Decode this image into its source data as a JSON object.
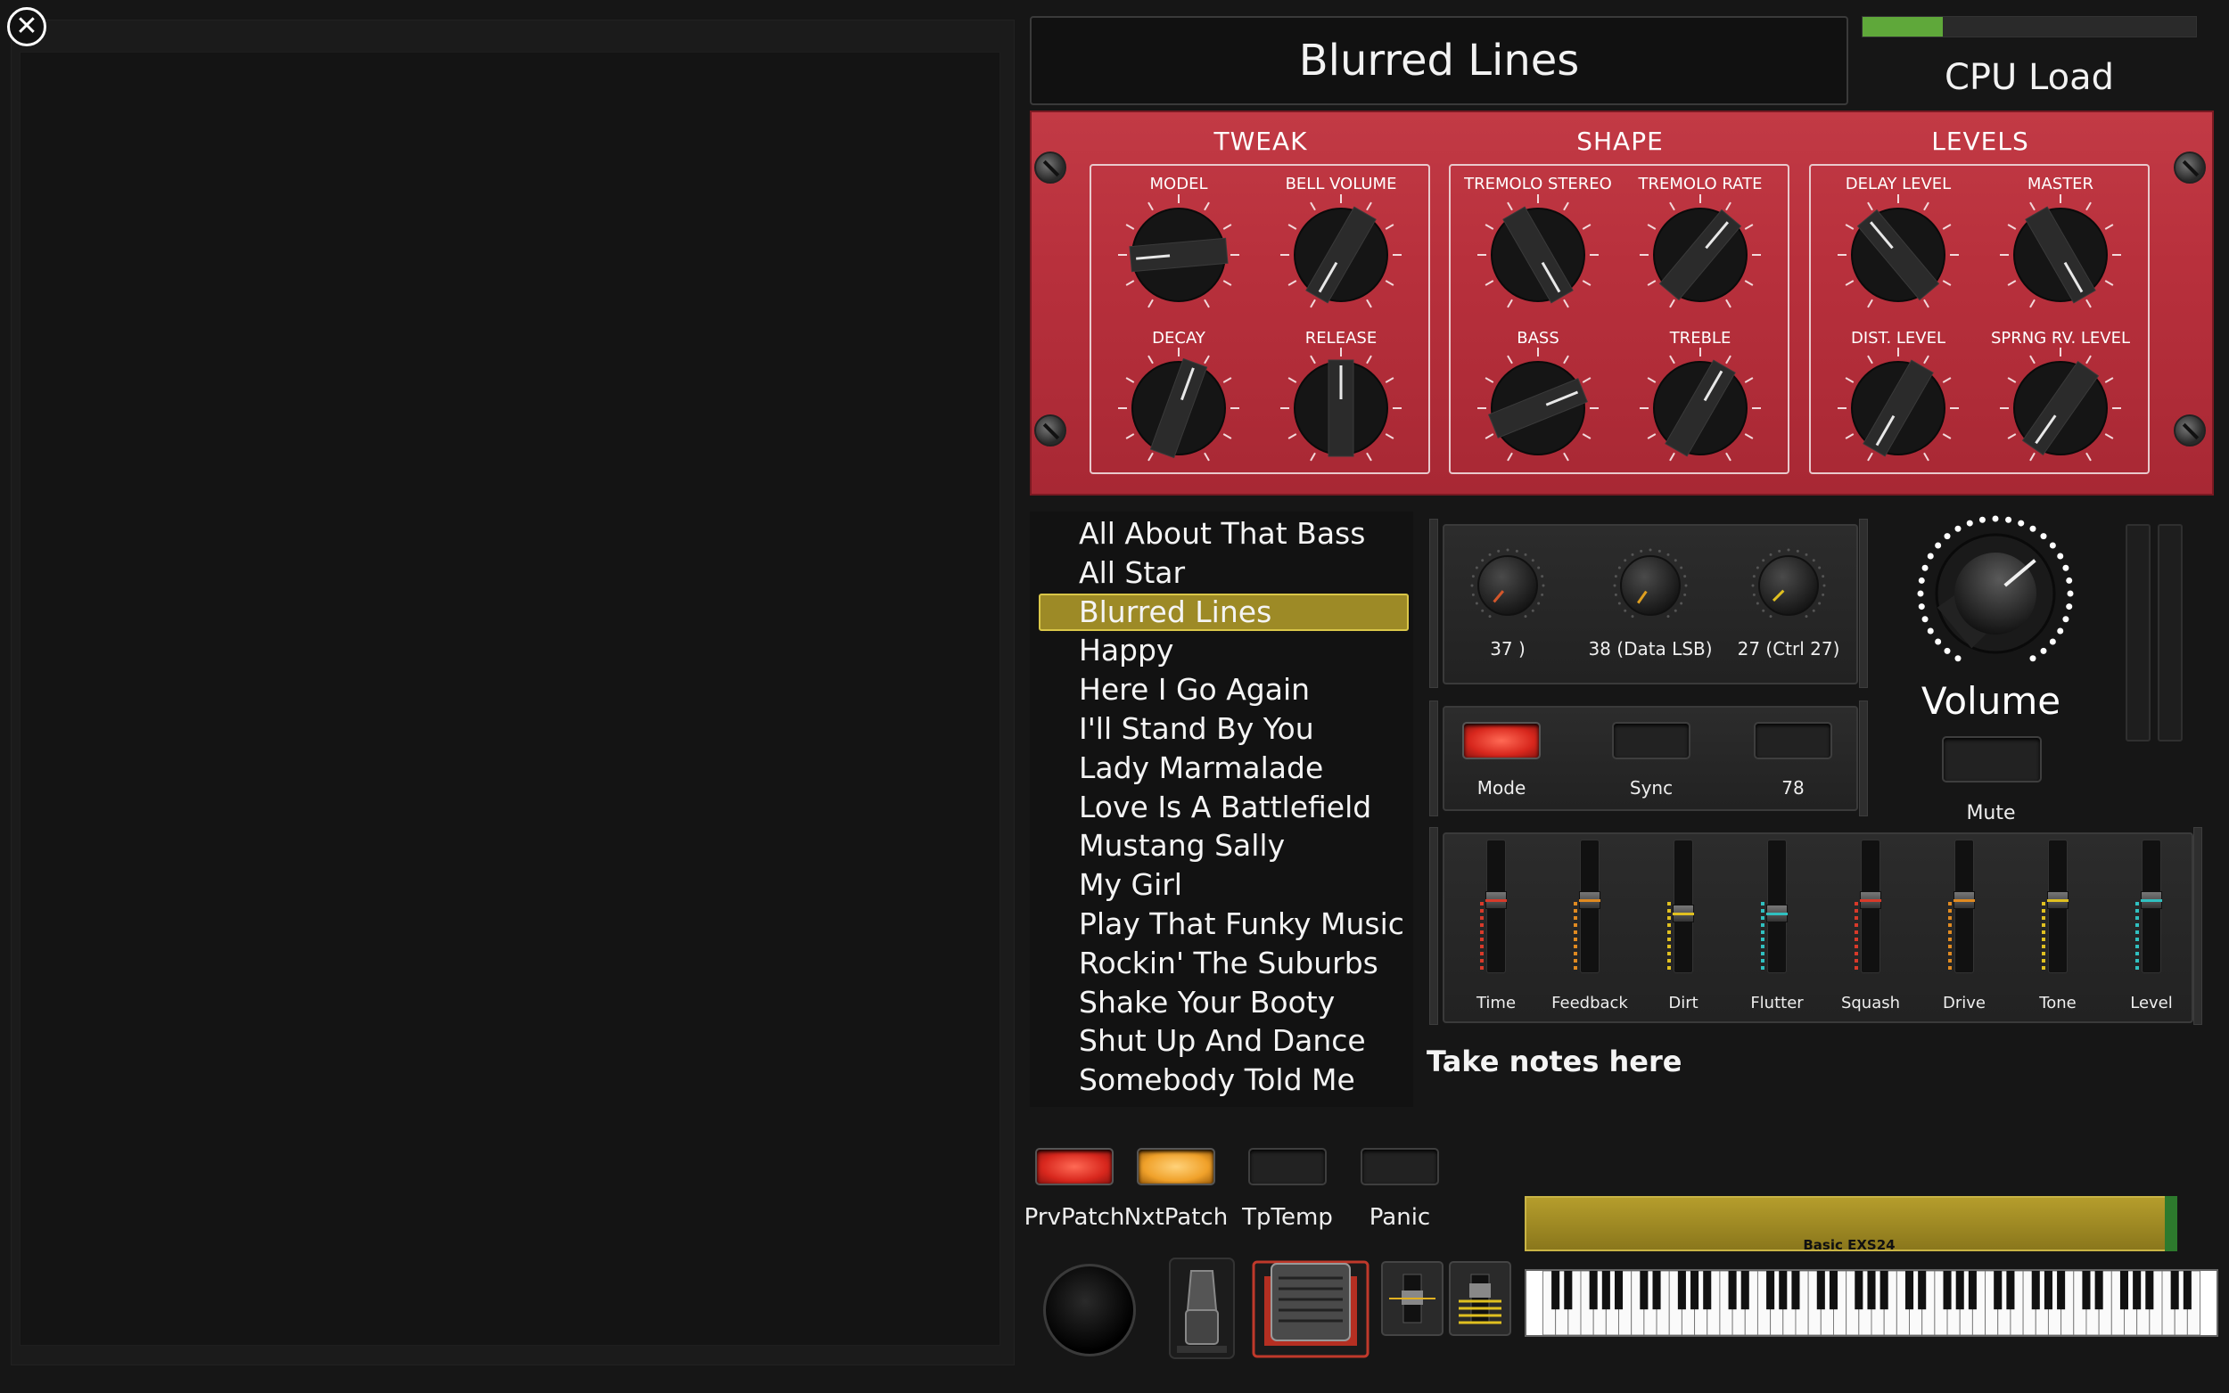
{
  "window": {
    "close_icon": "close-icon"
  },
  "header": {
    "patch_title": "Blurred Lines",
    "cpu_label": "CPU Load",
    "cpu_load_fraction": 0.24
  },
  "panel": {
    "sections": [
      {
        "title": "TWEAK",
        "knobs": [
          {
            "label": "MODEL",
            "angle": -95
          },
          {
            "label": "BELL VOLUME",
            "angle": -150
          },
          {
            "label": "DECAY",
            "angle": 20
          },
          {
            "label": "RELEASE",
            "angle": 0
          }
        ]
      },
      {
        "title": "SHAPE",
        "knobs": [
          {
            "label": "TREMOLO STEREO",
            "angle": 150
          },
          {
            "label": "TREMOLO RATE",
            "angle": 40
          },
          {
            "label": "BASS",
            "angle": 68
          },
          {
            "label": "TREBLE",
            "angle": 30
          }
        ]
      },
      {
        "title": "LEVELS",
        "knobs": [
          {
            "label": "DELAY LEVEL",
            "angle": -40
          },
          {
            "label": "MASTER",
            "angle": 150
          },
          {
            "label": "DIST. LEVEL",
            "angle": -150
          },
          {
            "label": "SPRNG RV. LEVEL",
            "angle": -145
          }
        ]
      }
    ]
  },
  "patches": {
    "items": [
      "All About That Bass",
      "All Star",
      "Blurred Lines",
      "Happy",
      "Here I Go Again",
      "I'll Stand By You",
      "Lady Marmalade",
      "Love Is A Battlefield",
      "Mustang Sally",
      "My Girl",
      "Play That Funky Music",
      "Rockin' The Suburbs",
      "Shake Your Booty",
      "Shut Up And Dance",
      "Somebody Told Me"
    ],
    "selected_index": 2
  },
  "small_knobs": [
    {
      "label": "37 )",
      "color": "#d4572b",
      "angle": -140
    },
    {
      "label": "38 (Data LSB)",
      "color": "#e0a020",
      "angle": -145
    },
    {
      "label": "27 (Ctrl 27)",
      "color": "#e0c020",
      "angle": -135
    }
  ],
  "buttons": [
    {
      "label": "Mode",
      "state": "red"
    },
    {
      "label": "Sync",
      "state": "off"
    },
    {
      "label": "78",
      "state": "off"
    }
  ],
  "volume": {
    "label": "Volume",
    "mute_label": "Mute",
    "angle": 50
  },
  "faders": [
    {
      "label": "Time",
      "color": "#d83a2a",
      "level": 0.55
    },
    {
      "label": "Feedback",
      "color": "#e08a20",
      "level": 0.55
    },
    {
      "label": "Dirt",
      "color": "#e0c020",
      "level": 0.45
    },
    {
      "label": "Flutter",
      "color": "#30c0c0",
      "level": 0.45
    },
    {
      "label": "Squash",
      "color": "#d83a2a",
      "level": 0.55
    },
    {
      "label": "Drive",
      "color": "#e08a20",
      "level": 0.55
    },
    {
      "label": "Tone",
      "color": "#e0c020",
      "level": 0.55
    },
    {
      "label": "Level",
      "color": "#30c0c0",
      "level": 0.55
    }
  ],
  "notes": {
    "text": "Take notes here"
  },
  "footer": {
    "buttons": [
      {
        "label": "PrvPatch",
        "state": "red"
      },
      {
        "label": "NxtPatch",
        "state": "orange"
      },
      {
        "label": "TpTemp",
        "state": "off"
      },
      {
        "label": "Panic",
        "state": "off"
      }
    ],
    "instrument": "Basic EXS24"
  }
}
